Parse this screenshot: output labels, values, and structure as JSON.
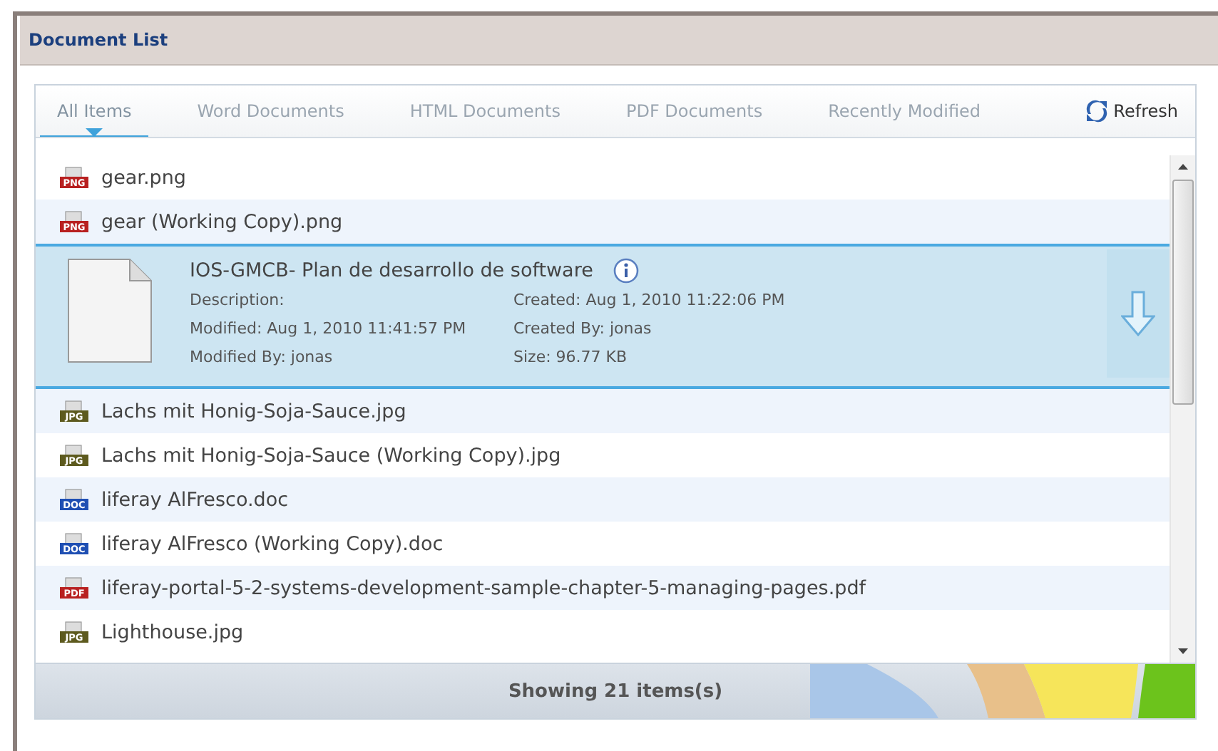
{
  "header": {
    "title": "Document List"
  },
  "tabs": [
    {
      "label": "All Items",
      "selected": true
    },
    {
      "label": "Word Documents",
      "selected": false
    },
    {
      "label": "HTML Documents",
      "selected": false
    },
    {
      "label": "PDF Documents",
      "selected": false
    },
    {
      "label": "Recently Modified",
      "selected": false
    }
  ],
  "refresh": {
    "label": "Refresh"
  },
  "items": [
    {
      "kind": "file",
      "type": "PNG",
      "name": "gear.png"
    },
    {
      "kind": "file",
      "type": "PNG",
      "name": "gear (Working Copy).png"
    },
    {
      "kind": "expanded",
      "name": "IOS-GMCB- Plan de desarrollo de software",
      "details_left": [
        "Description:",
        "Modified: Aug 1, 2010 11:41:57 PM",
        "Modified By: jonas"
      ],
      "details_right": [
        "Created: Aug 1, 2010 11:22:06 PM",
        "Created By: jonas",
        "Size: 96.77 KB"
      ]
    },
    {
      "kind": "file",
      "type": "JPG",
      "name": "Lachs mit Honig-Soja-Sauce.jpg"
    },
    {
      "kind": "file",
      "type": "JPG",
      "name": "Lachs mit Honig-Soja-Sauce (Working Copy).jpg"
    },
    {
      "kind": "file",
      "type": "DOC",
      "name": "liferay AlFresco.doc"
    },
    {
      "kind": "file",
      "type": "DOC",
      "name": "liferay AlFresco (Working Copy).doc"
    },
    {
      "kind": "file",
      "type": "PDF",
      "name": "liferay-portal-5-2-systems-development-sample-chapter-5-managing-pages.pdf"
    },
    {
      "kind": "file",
      "type": "JPG",
      "name": "Lighthouse.jpg"
    }
  ],
  "status": "Showing 21 items(s)"
}
